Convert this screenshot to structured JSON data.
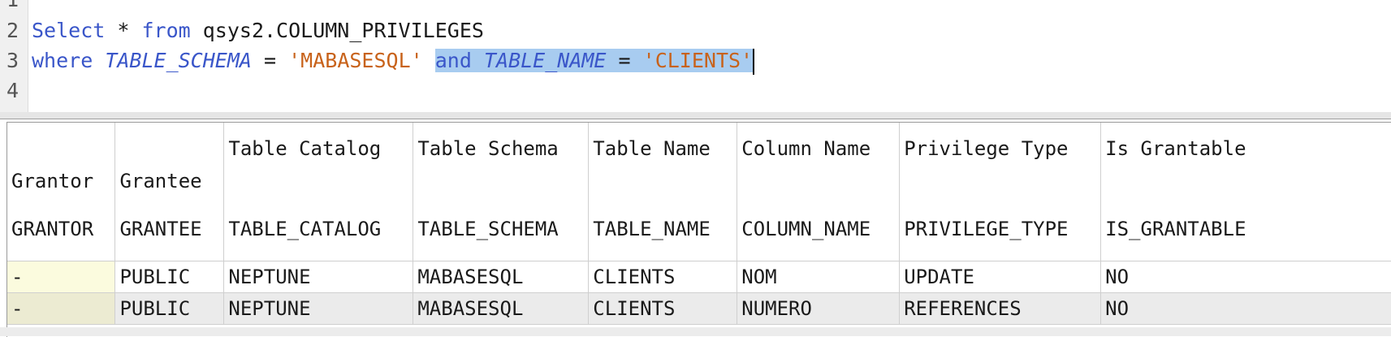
{
  "editor": {
    "lines": [
      {
        "number": "1"
      },
      {
        "number": "2",
        "kw_select": "Select",
        "star": " * ",
        "kw_from": "from",
        "rest": " qsys2.COLUMN_PRIVILEGES"
      },
      {
        "number": "3",
        "kw_where": "where",
        "ident_schema": "TABLE_SCHEMA",
        "eq1": " = ",
        "str_schema": "'MABASESQL'",
        "gap": " ",
        "kw_and": "and",
        "sp": " ",
        "ident_name": "TABLE_NAME",
        "eq2": " = ",
        "str_name": "'CLIENTS'"
      },
      {
        "number": "4"
      }
    ]
  },
  "grid": {
    "columns": [
      {
        "label": "Grantor",
        "name": "GRANTOR"
      },
      {
        "label": "Grantee",
        "name": "GRANTEE"
      },
      {
        "label": "Table Catalog",
        "name": "TABLE_CATALOG"
      },
      {
        "label": "Table Schema",
        "name": "TABLE_SCHEMA"
      },
      {
        "label": "Table Name",
        "name": "TABLE_NAME"
      },
      {
        "label": "Column Name",
        "name": "COLUMN_NAME"
      },
      {
        "label": "Privilege Type",
        "name": "PRIVILEGE_TYPE"
      },
      {
        "label": "Is Grantable",
        "name": "IS_GRANTABLE"
      }
    ],
    "rows": [
      [
        "-",
        "PUBLIC",
        "NEPTUNE",
        "MABASESQL",
        "CLIENTS",
        "NOM",
        "UPDATE",
        "NO"
      ],
      [
        "-",
        "PUBLIC",
        "NEPTUNE",
        "MABASESQL",
        "CLIENTS",
        "NUMERO",
        "REFERENCES",
        "NO"
      ]
    ]
  },
  "colors": {
    "keyword": "#3a56c9",
    "string": "#c8621a",
    "selection": "#a8ccf0",
    "alt_row": "#ebebeb",
    "grantor_cell": "#fbfbde"
  }
}
